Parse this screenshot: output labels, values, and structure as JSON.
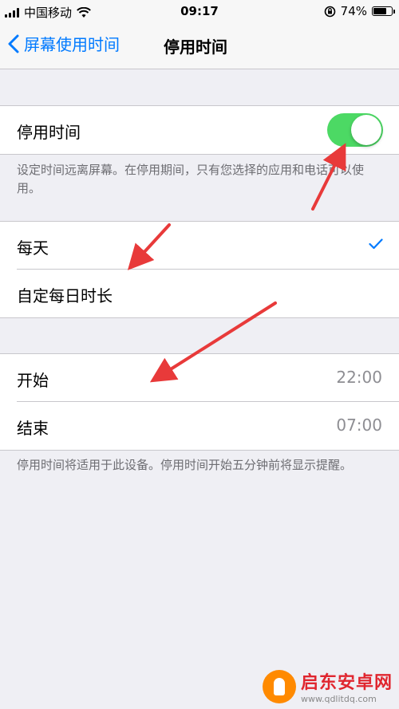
{
  "status_bar": {
    "carrier": "中国移动",
    "time": "09:17",
    "battery": "74%",
    "battery_level": 0.74
  },
  "nav": {
    "back_label": "屏幕使用时间",
    "title": "停用时间"
  },
  "downtime": {
    "label": "停用时间",
    "enabled": true,
    "description": "设定时间远离屏幕。在停用期间，只有您选择的应用和电话可以使用。"
  },
  "schedule": {
    "items": [
      {
        "label": "每天",
        "selected": true
      },
      {
        "label": "自定每日时长",
        "selected": false
      }
    ]
  },
  "times": {
    "start_label": "开始",
    "start_value": "22:00",
    "end_label": "结束",
    "end_value": "07:00",
    "description": "停用时间将适用于此设备。停用时间开始五分钟前将显示提醒。"
  },
  "watermark": {
    "name": "启东安卓网",
    "url": "www.qdlitdq.com"
  },
  "colors": {
    "accent": "#007aff",
    "toggle_on": "#4cd964",
    "arrow": "#e83a3a"
  }
}
